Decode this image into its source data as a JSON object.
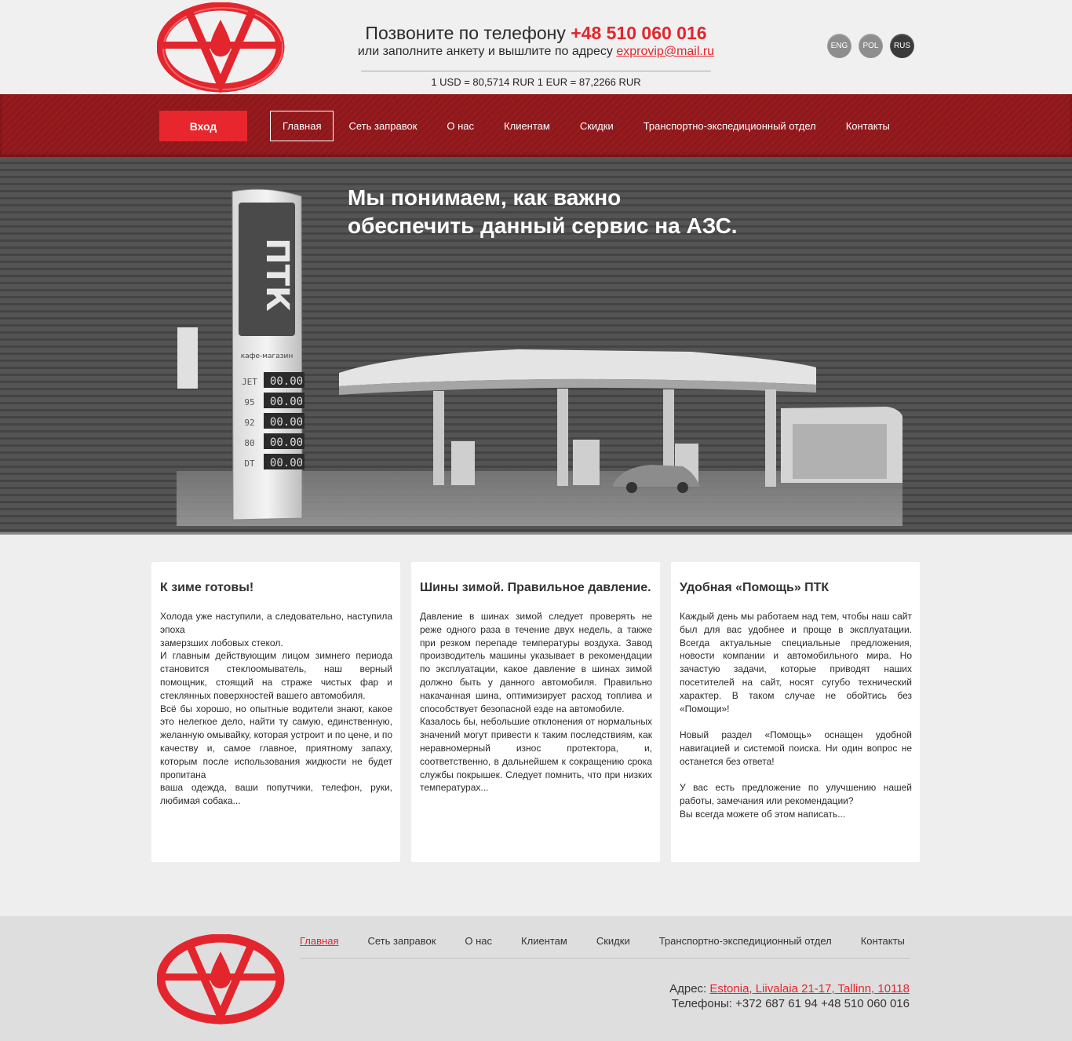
{
  "header": {
    "call_prefix": "Позвоните по телефону",
    "phone": "+48 510 060 016",
    "mail_prefix": "или заполните анкету и вышлите по адресу",
    "email": "exprovip@mail.ru",
    "rates": "1 USD = 80,5714 RUR 1 EUR = 87,2266 RUR",
    "languages": [
      "ENG",
      "POL",
      "RUS"
    ],
    "active_language": "RUS"
  },
  "nav": {
    "login": "Вход",
    "items": [
      "Главная",
      "Сеть заправок",
      "О нас",
      "Клиентам",
      "Скидки",
      "Транспортно-экспедиционный отдел",
      "Контакты"
    ],
    "active": "Главная"
  },
  "hero": {
    "title_line1": "Мы понимаем, как важно",
    "title_line2": "обеспечить данный сервис на АЗС.",
    "station_brand": "ПТК",
    "shop_label": "кафе-магазин",
    "fuel_prices": [
      {
        "grade": "JET",
        "price": "00.00"
      },
      {
        "grade": "95",
        "price": "00.00"
      },
      {
        "grade": "92",
        "price": "00.00"
      },
      {
        "grade": "80",
        "price": "00.00"
      },
      {
        "grade": "DT",
        "price": "00.00"
      }
    ]
  },
  "cards": [
    {
      "title": "К зиме готовы!",
      "body": "Холода уже наступили, а следовательно, наступила эпоха\nзамерзших лобовых стекол.\nИ главным действующим лицом зимнего периода становится стеклоомыватель, наш верный помощник, стоящий на страже чистых фар и стеклянных поверхностей вашего автомобиля.\nВсё бы хорошо, но опытные водители знают, какое это нелегкое дело, найти ту самую, единственную, желанную омывайку, которая устроит и по цене, и по качеству и, самое главное, приятному запаху, которым после использования жидкости не будет пропитана\nваша одежда, ваши попутчики, телефон, руки, любимая собака..."
    },
    {
      "title": "Шины зимой. Правильное давление.",
      "body": "Давление в шинах зимой следует проверять не реже одного раза в течение двух недель, а также при резком перепаде температуры воздуха. Завод производитель машины указывает в рекомендации по эксплуатации, какое давление в шинах зимой должно быть у данного автомобиля. Правильно накачанная шина, оптимизирует расход топлива и способствует безопасной езде на автомобиле.\nКазалось бы, небольшие отклонения от нормальных значений могут привести к таким последствиям, как неравномерный износ протектора, и, соответственно, в дальнейшем к сокращению срока службы покрышек. Следует помнить, что при низких температурах..."
    },
    {
      "title": "Удобная «Помощь» ПТК",
      "body": "Каждый день мы работаем над тем, чтобы наш сайт был для вас  удобнее и проще в эксплуатации. Всегда актуальные специальные предложения, новости компании и автомобильного мира.  Но зачастую задачи, которые приводят наших посетителей на сайт, носят сугубо технический характер. В таком случае не обойтись без «Помощи»!\n\nНовый раздел «Помощь» оснащен удобной навигацией и системой поиска. Ни один вопрос не останется без ответа!\n\nУ вас есть предложение по улучшению нашей работы, замечания или рекомендации?\nВы всегда можете об этом написать..."
    }
  ],
  "footer": {
    "nav": [
      "Главная",
      "Сеть заправок",
      "О нас",
      "Клиентам",
      "Скидки",
      "Транспортно-экспедиционный отдел",
      "Контакты"
    ],
    "address_label": "Адрес:",
    "address": "Estonia, Liivalaia 21-17, Tallinn, 10118",
    "phones_label": "Телефоны:",
    "phones": "+372 687 61 94  +48 510 060 016"
  },
  "colors": {
    "accent": "#e3262d",
    "nav_bg": "#931a1e",
    "hero_bg": "#4d4d4d"
  }
}
